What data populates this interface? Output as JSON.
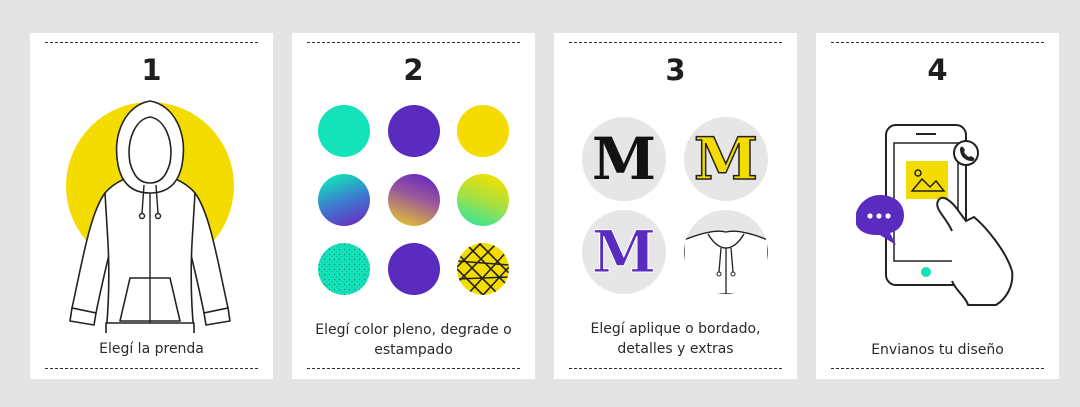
{
  "steps": [
    {
      "number": "1",
      "caption": "Elegí la prenda"
    },
    {
      "number": "2",
      "caption_line1": "Elegí color pleno, degrade o",
      "caption_line2": "estampado"
    },
    {
      "number": "3",
      "caption_line1": "Elegí aplique o bordado,",
      "caption_line2": "detalles y extras"
    },
    {
      "number": "4",
      "caption": "Envianos tu diseño"
    }
  ],
  "letters": {
    "m1": "M",
    "m2": "M",
    "m3": "M"
  },
  "colors": {
    "accent_yellow": "#f5dc00",
    "teal": "#14e2b8",
    "purple": "#5a2bbf",
    "dark": "#1e1e1e"
  },
  "icons": {
    "step1": "hoodie-icon",
    "step2": [
      "solid-teal",
      "solid-purple",
      "solid-yellow",
      "gradient-teal-purple",
      "gradient-purple-yellow",
      "gradient-yellow-green",
      "pattern-dots",
      "solid-purple",
      "pattern-stripes"
    ],
    "step3": [
      "letter-m-black",
      "letter-m-yellow",
      "letter-m-purple",
      "hood-detail"
    ],
    "step4": [
      "phone-icon",
      "whatsapp-icon",
      "chat-bubble-icon",
      "image-icon"
    ]
  }
}
